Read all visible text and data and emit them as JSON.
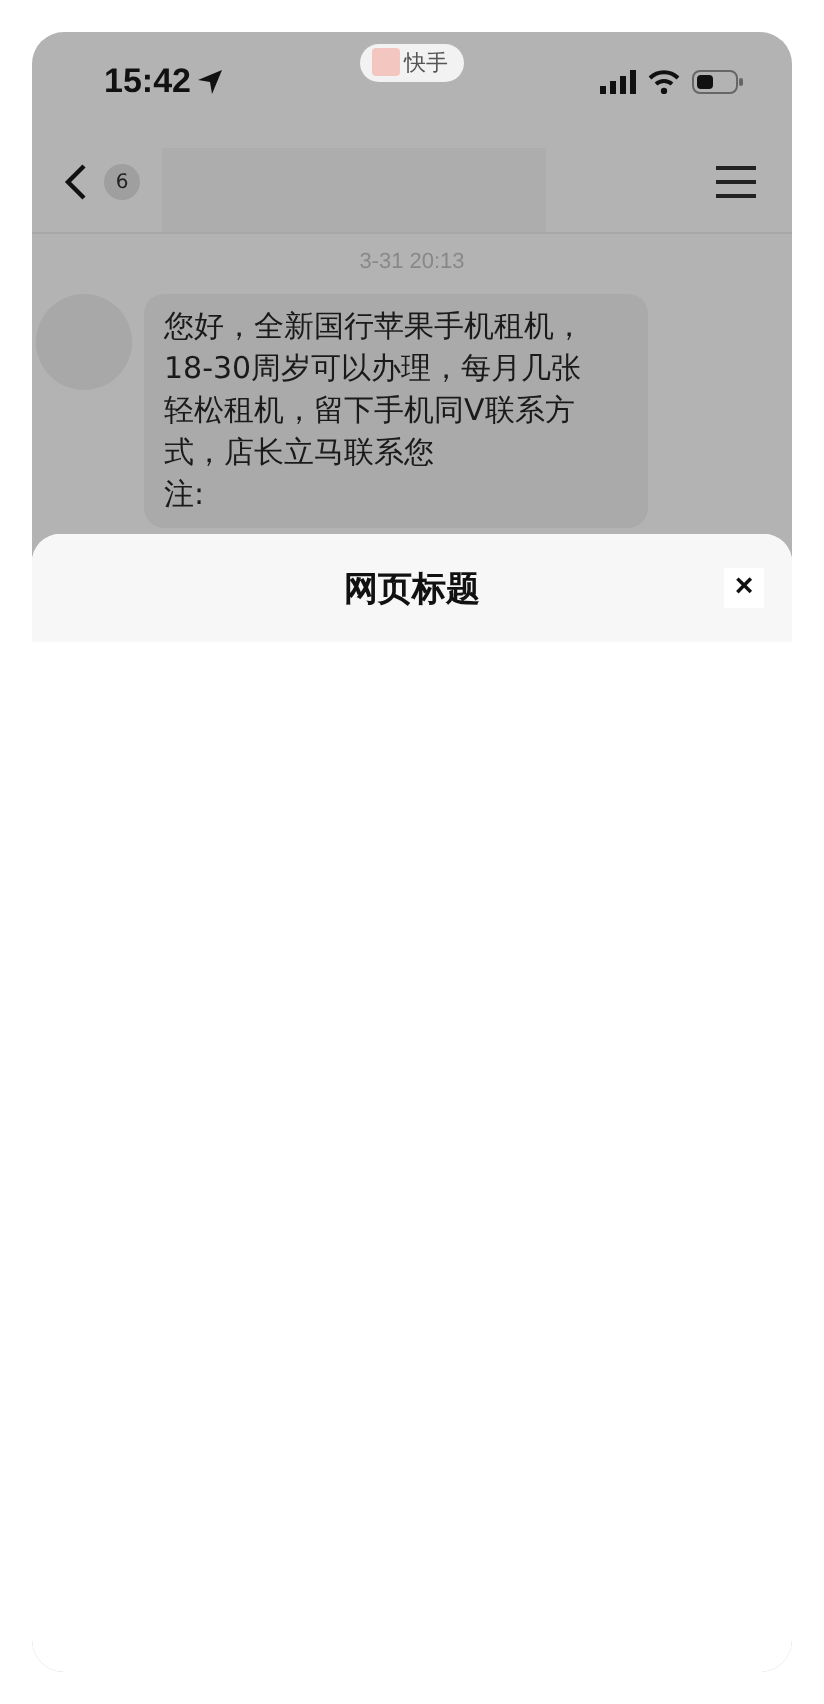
{
  "status_bar": {
    "time": "15:42",
    "app_pill": "快手"
  },
  "nav": {
    "badge": "6"
  },
  "chat": {
    "timestamp": "3-31 20:13",
    "message_lines": [
      "您好，全新国行苹果手机租机，",
      "18-30周岁可以办理，每月几张",
      "轻松租机，留下手机同V联系方",
      "式，店长立马联系您",
      "注:"
    ]
  },
  "sheet": {
    "title": "网页标题",
    "close": "×"
  }
}
